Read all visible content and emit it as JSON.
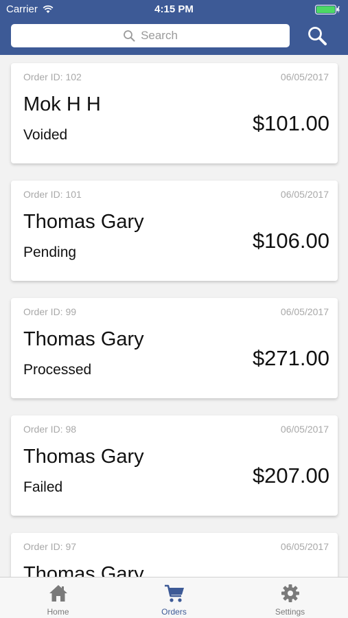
{
  "status_bar": {
    "carrier": "Carrier",
    "time": "4:15 PM"
  },
  "search": {
    "placeholder": "Search"
  },
  "orders": [
    {
      "id_label": "Order ID: 102",
      "date": "06/05/2017",
      "name": "Mok H H",
      "status": "Voided",
      "amount": "$101.00"
    },
    {
      "id_label": "Order ID: 101",
      "date": "06/05/2017",
      "name": "Thomas Gary",
      "status": "Pending",
      "amount": "$106.00"
    },
    {
      "id_label": "Order ID: 99",
      "date": "06/05/2017",
      "name": "Thomas Gary",
      "status": "Processed",
      "amount": "$271.00"
    },
    {
      "id_label": "Order ID: 98",
      "date": "06/05/2017",
      "name": "Thomas Gary",
      "status": "Failed",
      "amount": "$207.00"
    },
    {
      "id_label": "Order ID: 97",
      "date": "06/05/2017",
      "name": "Thomas Gary",
      "status": "",
      "amount": ""
    }
  ],
  "tabs": [
    {
      "label": "Home",
      "icon": "home-icon",
      "active": false
    },
    {
      "label": "Orders",
      "icon": "cart-icon",
      "active": true
    },
    {
      "label": "Settings",
      "icon": "gear-icon",
      "active": false
    }
  ],
  "colors": {
    "brand": "#3d5a96",
    "battery": "#4cd964"
  }
}
